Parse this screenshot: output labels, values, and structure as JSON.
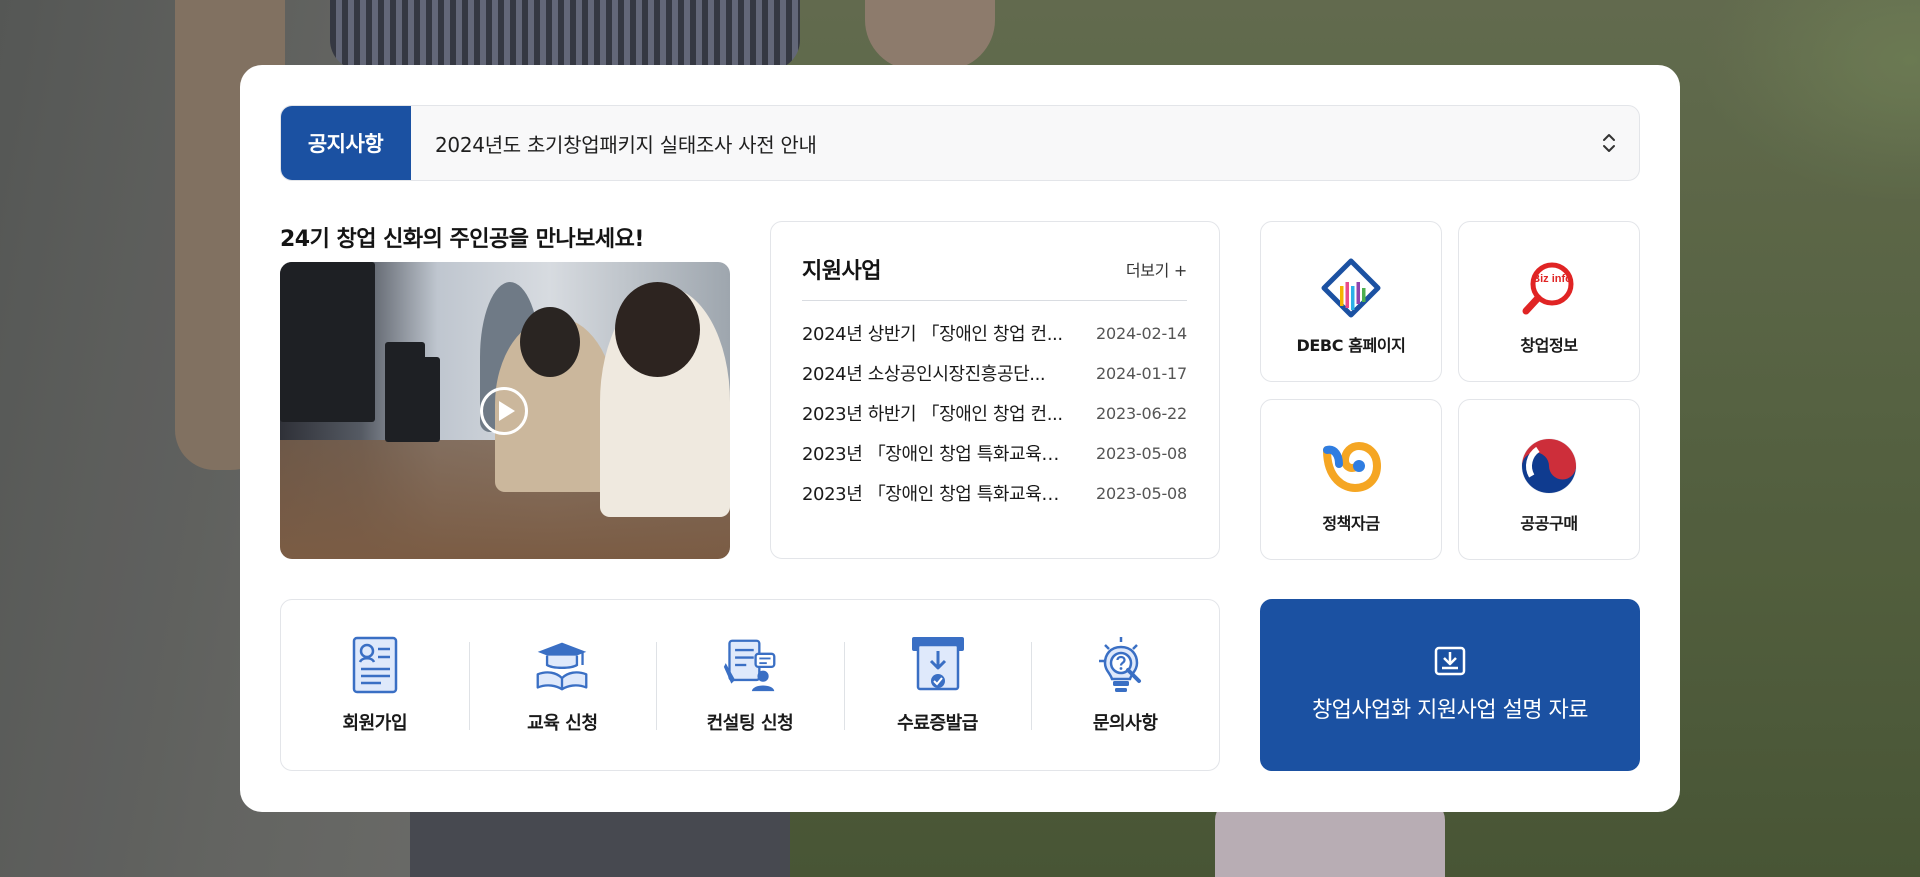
{
  "notice": {
    "label": "공지사항",
    "text": "2024년도 초기창업패키지 실태조사 사전 안내"
  },
  "video": {
    "title": "24기 창업 신화의 주인공을 만나보세요!"
  },
  "support": {
    "title": "지원사업",
    "more_label": "더보기 +",
    "items": [
      {
        "title": "2024년 상반기 「장애인 창업 컨...",
        "date": "2024-02-14"
      },
      {
        "title": "2024년 소상공인시장진흥공단...",
        "date": "2024-01-17"
      },
      {
        "title": "2023년 하반기 「장애인 창업 컨...",
        "date": "2023-06-22"
      },
      {
        "title": "2023년 「장애인 창업 특화교육」...",
        "date": "2023-05-08"
      },
      {
        "title": "2023년 「장애인 창업 특화교육」...",
        "date": "2023-05-08"
      }
    ]
  },
  "tiles": [
    {
      "label": "DEBC 홈페이지",
      "icon": "debc-logo-icon"
    },
    {
      "label": "창업정보",
      "icon": "bizinfo-logo-icon"
    },
    {
      "label": "정책자금",
      "icon": "policy-fund-logo-icon"
    },
    {
      "label": "공공구매",
      "icon": "public-procurement-logo-icon"
    }
  ],
  "bizinfo_icon_text": "Biz info",
  "services": [
    {
      "label": "회원가입",
      "icon": "member-form-icon"
    },
    {
      "label": "교육 신청",
      "icon": "graduation-cap-book-icon"
    },
    {
      "label": "컨설팅 신청",
      "icon": "consulting-document-icon"
    },
    {
      "label": "수료증발급",
      "icon": "certificate-issue-icon"
    },
    {
      "label": "문의사항",
      "icon": "lightbulb-question-icon"
    }
  ],
  "download": {
    "label": "창업사업화 지원사업 설명 자료"
  },
  "colors": {
    "primary": "#1b51a2",
    "icon_blue": "#3a6fc4",
    "bizinfo_red": "#e02424"
  }
}
